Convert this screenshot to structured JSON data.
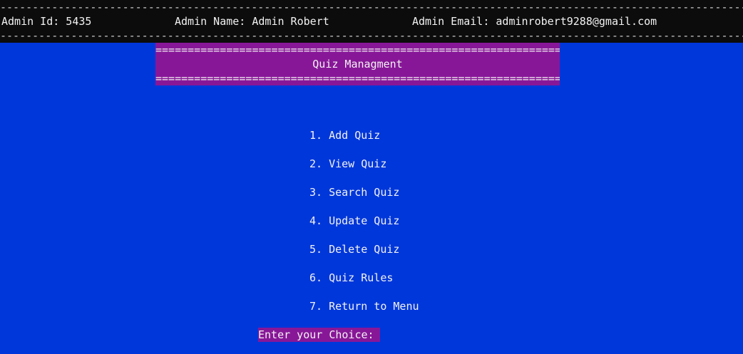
{
  "header": {
    "admin_id": "Admin Id: 5435",
    "admin_name": "Admin Name: Admin Robert",
    "admin_email": "Admin Email: adminrobert9288@gmail.com",
    "dash_top": "-------------------------------------------------------------------------------------------------------------------------------------------",
    "dash_bottom": "-------------------------------------------------------------------------------------------------------------------------------------------"
  },
  "title_box": {
    "eq_top": "===========================================================================",
    "title": "Quiz Managment",
    "eq_bottom": "==========================================================================="
  },
  "menu": [
    "1. Add Quiz",
    "2. View Quiz",
    "3. Search Quiz",
    "4. Update Quiz",
    "5. Delete Quiz",
    "6. Quiz Rules",
    "7. Return to Menu"
  ],
  "prompt": "Enter your Choice: ",
  "colors": {
    "background": "#0037da",
    "header_bar": "#0c0c0c",
    "accent": "#881798",
    "text": "#f2f2f2"
  }
}
